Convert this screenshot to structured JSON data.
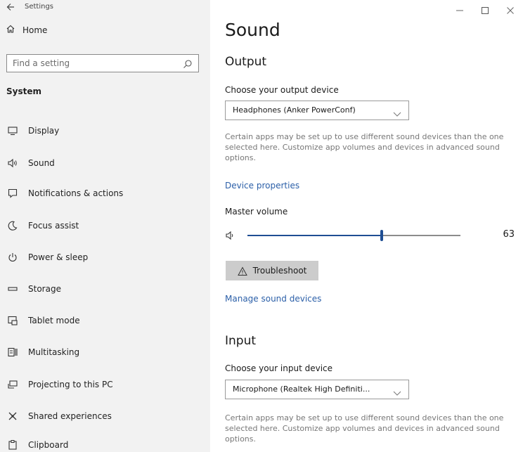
{
  "window": {
    "title": "Settings"
  },
  "sidebar": {
    "home_label": "Home",
    "search_placeholder": "Find a setting",
    "section_heading": "System",
    "items": [
      {
        "label": "Display",
        "icon": "display-icon"
      },
      {
        "label": "Sound",
        "icon": "speaker-icon"
      },
      {
        "label": "Notifications & actions",
        "icon": "notifications-icon"
      },
      {
        "label": "Focus assist",
        "icon": "moon-icon"
      },
      {
        "label": "Power & sleep",
        "icon": "power-icon"
      },
      {
        "label": "Storage",
        "icon": "storage-icon"
      },
      {
        "label": "Tablet mode",
        "icon": "tablet-mode-icon"
      },
      {
        "label": "Multitasking",
        "icon": "multitasking-icon"
      },
      {
        "label": "Projecting to this PC",
        "icon": "projecting-icon"
      },
      {
        "label": "Shared experiences",
        "icon": "shared-experiences-icon"
      },
      {
        "label": "Clipboard",
        "icon": "clipboard-icon"
      }
    ]
  },
  "main": {
    "page_title": "Sound",
    "output": {
      "heading": "Output",
      "choose_label": "Choose your output device",
      "device": "Headphones (Anker PowerConf)",
      "description": "Certain apps may be set up to use different sound devices than the one selected here. Customize app volumes and devices in advanced sound options.",
      "device_properties_link": "Device properties",
      "master_volume_label": "Master volume",
      "volume": 63,
      "volume_text": "63",
      "troubleshoot_label": "Troubleshoot",
      "manage_link": "Manage sound devices"
    },
    "input": {
      "heading": "Input",
      "choose_label": "Choose your input device",
      "device": "Microphone (Realtek High Definiti...",
      "description": "Certain apps may be set up to use different sound devices than the one selected here. Customize app volumes and devices in advanced sound options."
    }
  },
  "colors": {
    "sidebar_bg": "#f2f2f2",
    "accent": "#1f4e93",
    "link": "#2b5fa8",
    "button_bg": "#cccccc"
  }
}
